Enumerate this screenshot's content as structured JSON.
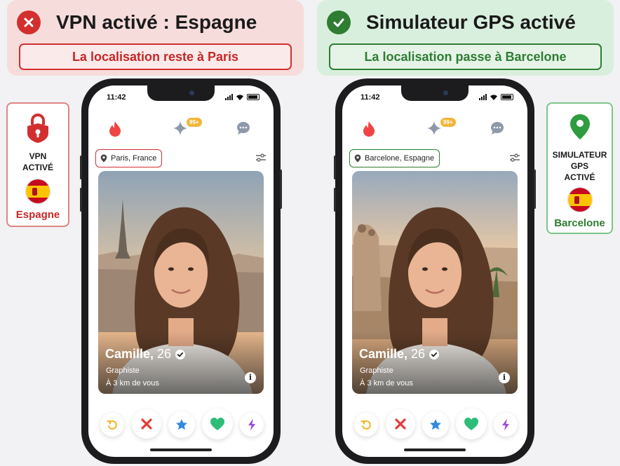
{
  "left_banner": {
    "title": "VPN activé : Espagne",
    "subtitle": "La localisation reste à Paris",
    "status": "x-icon",
    "color": "#d32f2f"
  },
  "right_banner": {
    "title": "Simulateur GPS activé",
    "subtitle": "La localisation passe à Barcelone",
    "status": "check-icon",
    "color": "#2e7d32"
  },
  "left_side_card": {
    "icon": "lock-icon",
    "label_line1": "VPN",
    "label_line2": "ACTIVÉ",
    "flag": "spain-flag",
    "place": "Espagne"
  },
  "right_side_card": {
    "icon": "map-pin-icon",
    "label_line1": "SIMULATEUR",
    "label_line2": "GPS",
    "label_line3": "ACTIVÉ",
    "flag": "spain-flag",
    "place": "Barcelone"
  },
  "phones": {
    "left": {
      "time": "11:42",
      "badge": "99+",
      "location": "Paris, France",
      "profile": {
        "name": "Camille,",
        "age": "26",
        "job": "Graphiste",
        "distance": "À 3 km de vous"
      }
    },
    "right": {
      "time": "11:42",
      "badge": "99+",
      "location": "Barcelone, Espagne",
      "profile": {
        "name": "Camille,",
        "age": "26",
        "job": "Graphiste",
        "distance": "À 3 km de vous"
      }
    }
  },
  "actions": [
    "rewind-icon",
    "nope-icon",
    "super-like-icon",
    "like-icon",
    "boost-icon"
  ],
  "colors": {
    "flame": "#ef4444",
    "rewind": "#f5b731",
    "nope": "#e53935",
    "super_like": "#2f8ae0",
    "like": "#2ebd78",
    "boost": "#9b4ce0"
  }
}
